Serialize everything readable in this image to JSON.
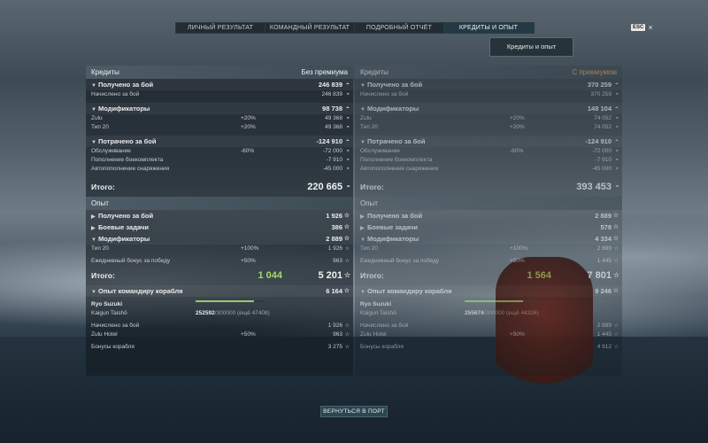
{
  "nav": {
    "tabs": [
      "ЛИЧНЫЙ РЕЗУЛЬТАТ",
      "КОМАНДНЫЙ РЕЗУЛЬТАТ",
      "ПОДРОБНЫЙ ОТЧЁТ",
      "КРЕДИТЫ И ОПЫТ"
    ],
    "active_tab": 3,
    "esc": "ESC",
    "close": "×"
  },
  "view_button": "Кредиты и опыт",
  "left": {
    "header": "Кредиты",
    "header_right": "Без премиума",
    "earned": {
      "label": "Получено за бой",
      "value": "246 839",
      "row_label": "Начислено за бой",
      "row_value": "246 839"
    },
    "mods": {
      "label": "Модификаторы",
      "value": "98 738",
      "rows": [
        {
          "l": "Zulu",
          "m": "+20%",
          "r": "49 368"
        },
        {
          "l": "Тип 20",
          "m": "+20%",
          "r": "49 368"
        }
      ]
    },
    "spent": {
      "label": "Потрачено за бой",
      "value": "-124 910",
      "rows": [
        {
          "l": "Обслуживание",
          "m": "-60%",
          "r": "-72 000"
        },
        {
          "l": "Пополнение боекомплекта",
          "m": "",
          "r": "-7 910"
        },
        {
          "l": "Автопополнение снаряжения",
          "m": "",
          "r": "-45 000"
        }
      ]
    },
    "total_label": "Итого:",
    "total": "220 665",
    "xp_header": "Опыт",
    "xp_earned": {
      "label": "Получено за бой",
      "value": "1 926"
    },
    "xp_tasks": {
      "label": "Боевые задачи",
      "value": "386"
    },
    "xp_mods": {
      "label": "Модификаторы",
      "value": "2 889",
      "rows": [
        {
          "l": "Тип 20",
          "m": "+100%",
          "r": "1 926"
        },
        {
          "l": "Ежедневный бонус за победу",
          "m": "+50%",
          "r": "963"
        }
      ]
    },
    "xp_total_label": "Итого:",
    "xp_total_green": "1 044",
    "xp_total": "5 201",
    "cmdr": {
      "label": "Опыт командиру корабля",
      "value": "6 164"
    },
    "captain": {
      "name": "Ryo Suzuki",
      "rank": "Kaigun Taishō",
      "xp": "252592",
      "xp_max": "/300000",
      "xp_left": "(ещё 47408)",
      "progress": 0.84
    },
    "cap_rows": [
      {
        "l": "Начислено за бой",
        "m": "",
        "r": "1 926"
      },
      {
        "l": "Zulu Hotel",
        "m": "+50%",
        "r": "963"
      }
    ],
    "ship_bonus": {
      "l": "Бонусы корабля",
      "r": "3 275"
    }
  },
  "right": {
    "header": "Кредиты",
    "header_right": "С премиумом",
    "earned": {
      "label": "Получено за бой",
      "value": "370 259",
      "row_label": "Начислено за бой",
      "row_value": "370 259"
    },
    "mods": {
      "label": "Модификаторы",
      "value": "148 104",
      "rows": [
        {
          "l": "Zulu",
          "m": "+20%",
          "r": "74 052"
        },
        {
          "l": "Тип 20",
          "m": "+20%",
          "r": "74 052"
        }
      ]
    },
    "spent": {
      "label": "Потрачено за бой",
      "value": "-124 910",
      "rows": [
        {
          "l": "Обслуживание",
          "m": "-60%",
          "r": "-72 000"
        },
        {
          "l": "Пополнение боекомплекта",
          "m": "",
          "r": "-7 910"
        },
        {
          "l": "Автопополнение снаряжения",
          "m": "",
          "r": "-45 000"
        }
      ]
    },
    "total_label": "Итого:",
    "total": "393 453",
    "xp_header": "Опыт",
    "xp_earned": {
      "label": "Получено за бой",
      "value": "2 889"
    },
    "xp_tasks": {
      "label": "Боевые задачи",
      "value": "578"
    },
    "xp_mods": {
      "label": "Модификаторы",
      "value": "4 334",
      "rows": [
        {
          "l": "Тип 20",
          "m": "+100%",
          "r": "2 889"
        },
        {
          "l": "Ежедневный бонус за победу",
          "m": "+50%",
          "r": "1 445"
        }
      ]
    },
    "xp_total_label": "Итого:",
    "xp_total_green": "1 564",
    "xp_total": "7 801",
    "cmdr": {
      "label": "Опыт командиру корабля",
      "value": "9 246"
    },
    "captain": {
      "name": "Ryo Suzuki",
      "rank": "Kaigun Taishō",
      "xp": "255674",
      "xp_max": "/300000",
      "xp_left": "(ещё 44326)",
      "progress": 0.85
    },
    "cap_rows": [
      {
        "l": "Начислено за бой",
        "m": "",
        "r": "2 889"
      },
      {
        "l": "Zulu Hotel",
        "m": "+50%",
        "r": "1 445"
      }
    ],
    "ship_bonus": {
      "l": "Бонусы корабля",
      "r": "4 912"
    }
  },
  "back_button": "ВЕРНУТЬСЯ В ПОРТ",
  "icons": {
    "credits": "coin-icon",
    "xp": "star-icon",
    "expand": "triangle-down-icon",
    "collapsed": "triangle-right-icon"
  },
  "colors": {
    "accent_green": "#a8d86a",
    "premium": "#e0a45a"
  }
}
